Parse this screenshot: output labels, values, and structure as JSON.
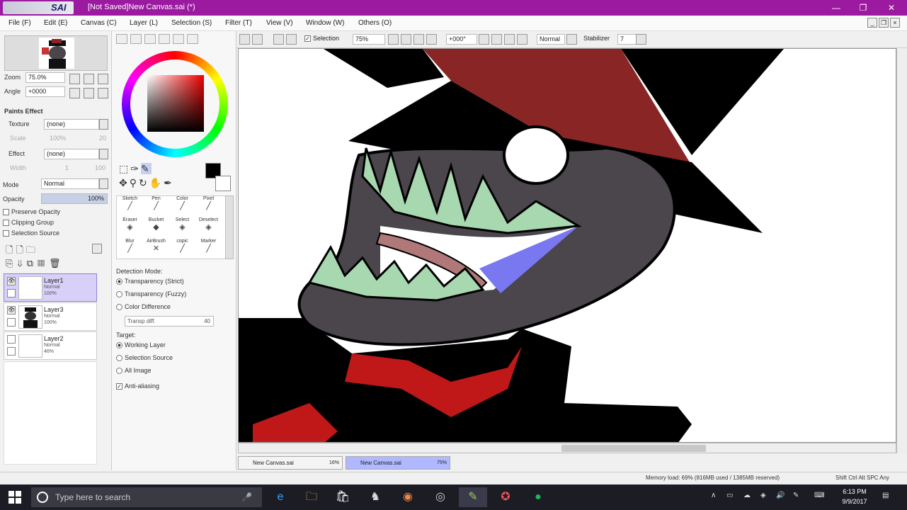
{
  "titlebar": {
    "app_name": "SAI",
    "title": "[Not Saved]New Canvas.sai (*)",
    "minimize": "—",
    "restore": "❐",
    "close": "✕"
  },
  "menu": [
    "File (F)",
    "Edit (E)",
    "Canvas (C)",
    "Layer (L)",
    "Selection (S)",
    "Filter (T)",
    "View (V)",
    "Window (W)",
    "Others (O)"
  ],
  "navigator": {
    "zoom_label": "Zoom",
    "zoom_value": "75.0%",
    "angle_label": "Angle",
    "angle_value": "+0000"
  },
  "paints_effect": {
    "header": "Paints Effect",
    "texture_label": "Texture",
    "texture_value": "(none)",
    "scale_label": "Scale",
    "scale_value": "100%",
    "scale_num": "20",
    "effect_label": "Effect",
    "effect_value": "(none)",
    "width_label": "Width",
    "width_value": "1",
    "width_num": "100"
  },
  "layer_props": {
    "mode_label": "Mode",
    "mode_value": "Normal",
    "opacity_label": "Opacity",
    "opacity_value": "100%",
    "preserve_opacity": "Preserve Opacity",
    "clipping_group": "Clipping Group",
    "selection_source": "Selection Source"
  },
  "layers": [
    {
      "name": "Layer1",
      "mode": "Normal",
      "opacity": "100%",
      "selected": true
    },
    {
      "name": "Layer3",
      "mode": "Normal",
      "opacity": "100%",
      "selected": false
    },
    {
      "name": "Layer2",
      "mode": "Normal",
      "opacity": "46%",
      "selected": false
    }
  ],
  "brushes": [
    [
      "Sketch",
      "Pen",
      "Color",
      "Pixel"
    ],
    [
      "Eraser",
      "Bucket",
      "Select",
      "Deselect"
    ],
    [
      "Blur",
      "AirBrush",
      "copic",
      "Marker"
    ]
  ],
  "tool_options": {
    "detection_label": "Detection Mode:",
    "opt1": "Transparency (Strict)",
    "opt2": "Transparency (Fuzzy)",
    "opt3": "Color Difference",
    "transp_label": "Transp diff.",
    "transp_value": "40",
    "target_label": "Target:",
    "target1": "Working Layer",
    "target2": "Selection Source",
    "target3": "All Image",
    "antialiasing": "Anti-aliasing"
  },
  "toolbar": {
    "selection_label": "Selection",
    "zoom_value": "75%",
    "angle_value": "+000°",
    "blend_value": "Normal",
    "stabilizer_label": "Stabilizer",
    "stabilizer_value": "7"
  },
  "doc_tabs": [
    {
      "name": "New Canvas.sai",
      "pct": "16%",
      "active": false
    },
    {
      "name": "New Canvas.sai",
      "pct": "75%",
      "active": true
    }
  ],
  "status": {
    "memory": "Memory load: 69% (816MB used / 1385MB reserved)",
    "keys": "Shift Ctrl Alt SPC Any"
  },
  "taskbar": {
    "search_placeholder": "Type here to search",
    "time": "6:13 PM",
    "date": "9/9/2017"
  },
  "colors": {
    "title_bg": "#9b1aa0",
    "selected_layer": "#d8d0f8",
    "active_tab": "#b0b8ff",
    "hat_red": "#8a2525",
    "face_gray": "#4a464c",
    "teeth_green": "#a8d8b0",
    "tongue_blue": "#7a78f0"
  }
}
